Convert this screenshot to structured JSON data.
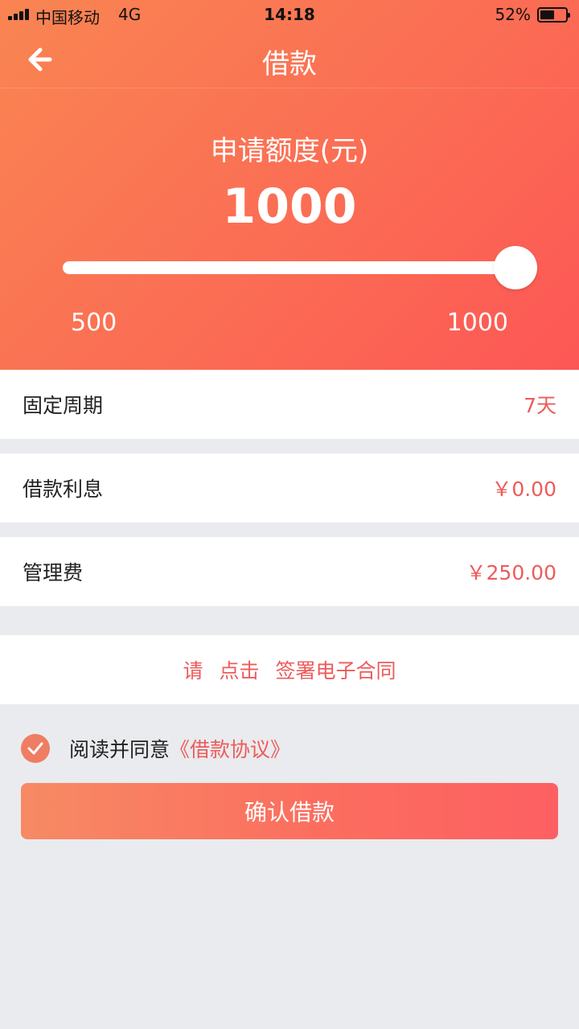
{
  "status_bar": {
    "carrier": "中国移动",
    "network": "4G",
    "time": "14:18",
    "battery": "52%"
  },
  "nav": {
    "back_icon": "arrow-left-icon",
    "title": "借款"
  },
  "loan": {
    "amount_label": "申请额度(元)",
    "amount": "1000",
    "slider_min": "500",
    "slider_max": "1000",
    "slider_fraction": 1.0
  },
  "details": [
    {
      "label": "固定周期",
      "value": "7天"
    },
    {
      "label": "借款利息",
      "value": "￥0.00"
    },
    {
      "label": "管理费",
      "value": "￥250.00"
    }
  ],
  "contract": {
    "label": "请 点击 签署电子合同"
  },
  "agreement": {
    "checked": true,
    "check_icon": "checkmark-icon",
    "text": "阅读并同意",
    "link": "《借款协议》"
  },
  "confirm": {
    "label": "确认借款"
  },
  "colors": {
    "accent": "#fb6d54",
    "value_red": "#ee5b5b",
    "background": "#e9ebee"
  }
}
